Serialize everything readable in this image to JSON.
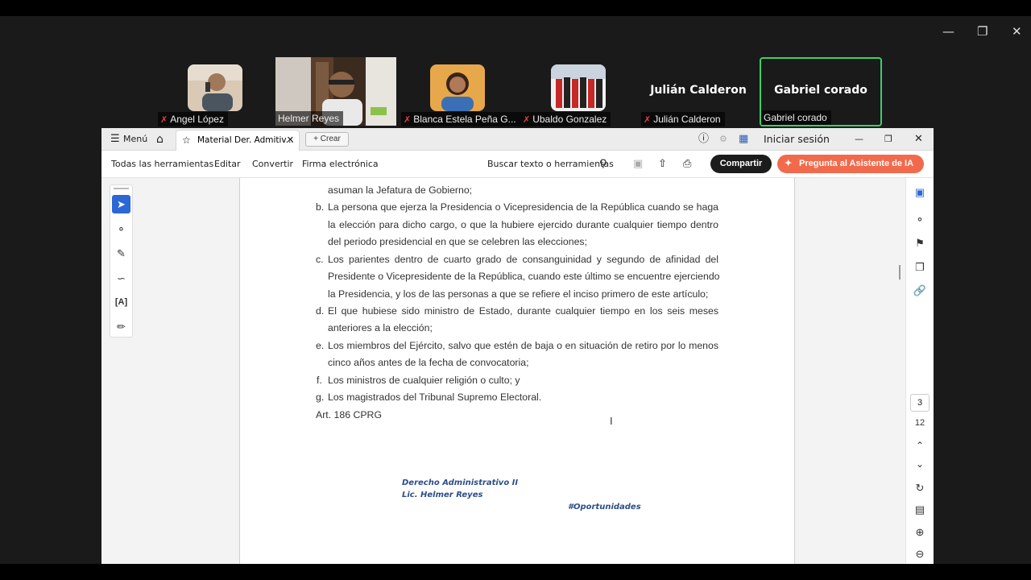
{
  "meeting": {
    "participants": [
      {
        "name": "Angel López",
        "muted": true
      },
      {
        "name": "Helmer Reyes",
        "muted": false
      },
      {
        "name": "Blanca Estela Peña G...",
        "muted": true
      },
      {
        "name": "Ubaldo Gonzalez",
        "muted": true
      },
      {
        "name": "Julián Calderon",
        "display": "Julián Calderon",
        "muted": true
      },
      {
        "name": "Gabriel corado",
        "display": "Gabriel corado",
        "muted": false,
        "active_speaker": true
      }
    ]
  },
  "acrobat": {
    "menu_label": "Menú",
    "doc_tab_title": "Material Der. Admitiv...",
    "create_label": "Crear",
    "sign_in": "Iniciar sesión",
    "toolbar": {
      "all_tools": "Todas las herramientas",
      "edit": "Editar",
      "convert": "Convertir",
      "esign": "Firma electrónica",
      "search": "Buscar texto o herramientas",
      "share": "Compartir",
      "ai_assistant": "Pregunta al Asistente de IA"
    },
    "page_nav": {
      "current": "3",
      "total": "12"
    }
  },
  "document": {
    "lines": [
      "asuman la Jefatura de Gobierno;",
      "b.",
      "La persona que ejerza la Presidencia o Vicepresidencia de la República cuando se haga",
      "la elección para dicho cargo, o que la hubiere ejercido durante cualquier tiempo dentro",
      "del periodo presidencial en que se celebren las elecciones;",
      "c.",
      "Los parientes dentro de cuarto grado de consanguinidad y segundo de afinidad del",
      "Presidente o Vicepresidente de la República, cuando este último se encuentre ejerciendo",
      "la Presidencia, y los de las personas a que se refiere el inciso primero de este artículo;",
      "d.",
      "El que hubiese sido ministro de Estado, durante cualquier tiempo en los seis meses",
      "anteriores a la elección;",
      "e.",
      "Los miembros del Ejército, salvo que estén de baja o en situación de retiro por lo menos",
      "cinco años antes de la fecha de convocatoria;",
      "f.",
      "Los ministros de cualquier religión o culto; y",
      "g.",
      "Los magistrados del Tribunal Supremo Electoral.",
      "Art. 186 CPRG"
    ],
    "footer": {
      "course": "Derecho Administrativo II",
      "teacher": "Lic. Helmer Reyes",
      "hashtag": "#Oportunidades"
    }
  }
}
